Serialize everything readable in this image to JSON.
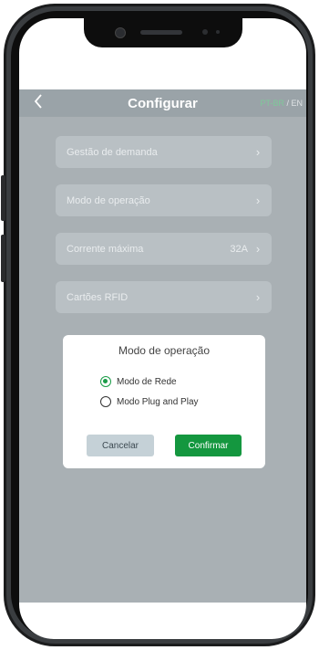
{
  "header": {
    "back_icon": "chevron-left-icon",
    "title": "Configurar",
    "lang_pt": "PT-BR",
    "lang_sep": " / ",
    "lang_en": "EN",
    "lang_active_color": "#7fc89a"
  },
  "menu": {
    "items": [
      {
        "label": "Gestão de demanda",
        "value": ""
      },
      {
        "label": "Modo de operação",
        "value": ""
      },
      {
        "label": "Corrente máxima",
        "value": "32A"
      },
      {
        "label": "Cartões RFID",
        "value": ""
      }
    ],
    "chevron": "›"
  },
  "dialog": {
    "title": "Modo de operação",
    "options": [
      {
        "label": "Modo de Rede",
        "selected": true
      },
      {
        "label": "Modo Plug and Play",
        "selected": false
      }
    ],
    "cancel_label": "Cancelar",
    "confirm_label": "Confirmar",
    "accent_color": "#14973f"
  }
}
